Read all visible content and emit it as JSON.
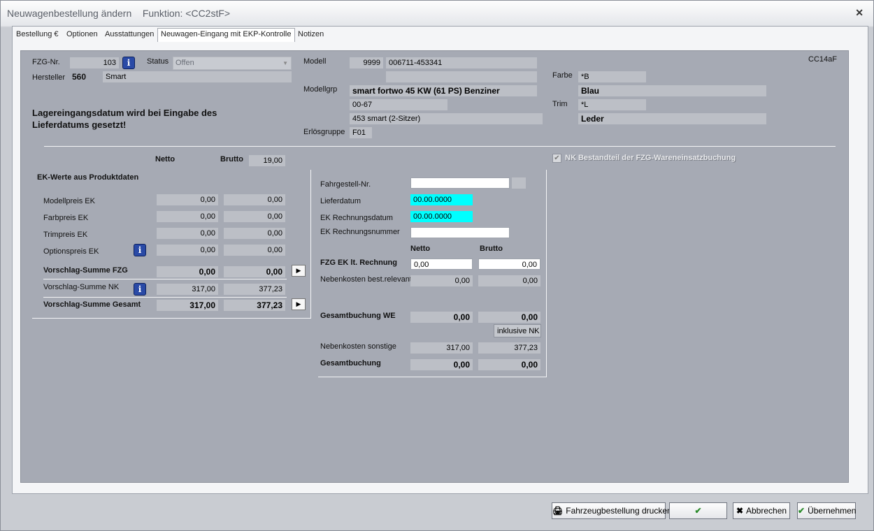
{
  "window": {
    "title": "Neuwagenbestellung ändern",
    "function": "Funktion: <CC2stF>",
    "close": "✕"
  },
  "tabs": [
    "Bestellung €",
    "Optionen",
    "Ausstattungen",
    "Neuwagen-Eingang mit EKP-Kontrolle",
    "Notizen"
  ],
  "header": {
    "code": "CC14aF",
    "fzg_label": "FZG-Nr.",
    "fzg_value": "103",
    "status_label": "Status",
    "status_value": "Offen",
    "hersteller_label": "Hersteller",
    "hersteller_code": "560",
    "hersteller_name": "Smart",
    "modell_label": "Modell",
    "modell_code": "9999",
    "modell_nr": "006711-453341",
    "modellgrp_label": "Modellgrp",
    "modellgrp_value": "smart fortwo 45 KW (61 PS) Benziner",
    "modellgrp_code": "00-67",
    "modellgrp_desc": "453 smart (2-Sitzer)",
    "erloes_label": "Erlösgruppe",
    "erloes_value": "F01",
    "farbe_label": "Farbe",
    "farbe_code": "*B",
    "farbe_name": "Blau",
    "trim_label": "Trim",
    "trim_code": "*L",
    "trim_name": "Leder",
    "notice": "Lagereingangsdatum wird bei Eingabe des Lieferdatums gesetzt!"
  },
  "ek": {
    "netto": "Netto",
    "brutto": "Brutto",
    "mwst": "19,00",
    "section": "EK-Werte aus Produktdaten",
    "rows": [
      {
        "label": "Modellpreis EK",
        "netto": "0,00",
        "brutto": "0,00"
      },
      {
        "label": "Farbpreis EK",
        "netto": "0,00",
        "brutto": "0,00"
      },
      {
        "label": "Trimpreis EK",
        "netto": "0,00",
        "brutto": "0,00"
      },
      {
        "label": "Optionspreis EK",
        "netto": "0,00",
        "brutto": "0,00"
      }
    ],
    "sum_fzg": {
      "label": "Vorschlag-Summe FZG",
      "netto": "0,00",
      "brutto": "0,00"
    },
    "sum_nk": {
      "label": "Vorschlag-Summe NK",
      "netto": "317,00",
      "brutto": "377,23"
    },
    "sum_total": {
      "label": "Vorschlag-Summe Gesamt",
      "netto": "317,00",
      "brutto": "377,23"
    }
  },
  "checkbox": {
    "label": "NK Bestandteil der FZG-Wareneinsatzbuchung",
    "checked": true
  },
  "right": {
    "fahrgestell_label": "Fahrgestell-Nr.",
    "fahrgestell_value": "",
    "liefer_label": "Lieferdatum",
    "liefer_value": "00.00.0000",
    "rechdat_label": "EK Rechnungsdatum",
    "rechdat_value": "00.00.0000",
    "rechnr_label": "EK Rechnungsnummer",
    "rechnr_value": "",
    "netto": "Netto",
    "brutto": "Brutto",
    "fzg_ek_label": "FZG EK lt. Rechnung",
    "fzg_ek_netto": "0,00",
    "fzg_ek_brutto": "0,00",
    "nk_best_label": "Nebenkosten best.relevant",
    "nk_best_netto": "0,00",
    "nk_best_brutto": "0,00",
    "gesamt_we_label": "Gesamtbuchung WE",
    "gesamt_we_netto": "0,00",
    "gesamt_we_brutto": "0,00",
    "inkl_nk": "inklusive NK",
    "nk_sonst_label": "Nebenkosten sonstige",
    "nk_sonst_netto": "317,00",
    "nk_sonst_brutto": "377,23",
    "gesamt_label": "Gesamtbuchung",
    "gesamt_netto": "0,00",
    "gesamt_brutto": "0,00"
  },
  "buttons": {
    "print": "Fahrzeugbestellung drucken",
    "ok": "✔",
    "cancel": "Abbrechen",
    "accept": "Übernehmen"
  }
}
